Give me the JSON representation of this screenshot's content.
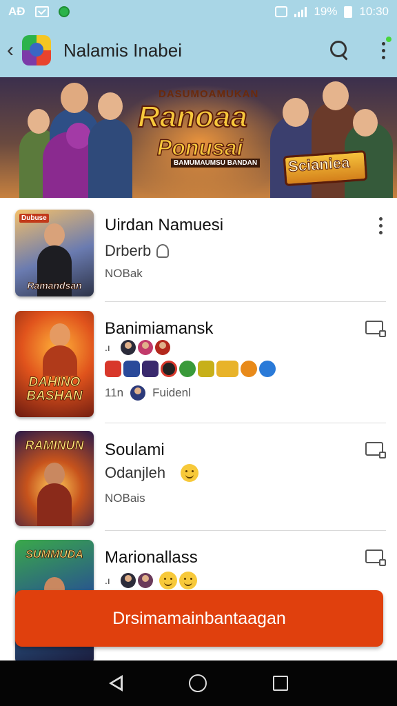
{
  "status_bar": {
    "carrier": "AĐ",
    "battery_percent": "19%",
    "time": "10:30"
  },
  "app_bar": {
    "title": "Nalamis Inabei"
  },
  "banner": {
    "subtitle": "DASUMOAMUKAN",
    "title_line1": "Ranoaa",
    "title_line2": "Ponusai",
    "tagline": "BAMUMAUMSU BANDAN",
    "side_title": "Scianiea"
  },
  "list": {
    "items": [
      {
        "name": "Uirdan Namuesi",
        "line2": "Drberb",
        "line3": "NOBak",
        "thumb_title": "Ramandsan",
        "thumb_badge": "Dubuse",
        "action": "more"
      },
      {
        "name": "Banimiamansk",
        "line3_count": "11n",
        "line3_text": "Fuidenl",
        "thumb_title": "DAHINO BASHAN",
        "action": "cast"
      },
      {
        "name": "Soulami",
        "line2": "Odanjleh",
        "line3": "NOBais",
        "thumb_title": "RAMINUN",
        "action": "cast"
      },
      {
        "name": "Marionallass",
        "thumb_title": "SUMMUDA",
        "action": "cast"
      }
    ]
  },
  "cta": {
    "label": "Drsimamainbantaagan"
  },
  "colors": {
    "app_bar": "#a9d6e6",
    "cta": "#e0400d",
    "nav_bar": "#050505"
  }
}
